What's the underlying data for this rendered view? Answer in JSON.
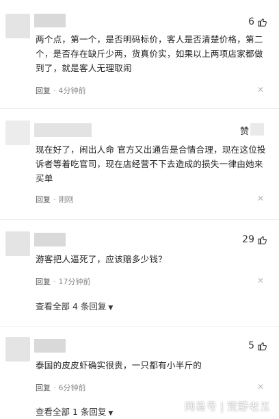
{
  "reply_label": "回复",
  "comments": [
    {
      "likes": "6",
      "text": "两个点，第一个，是否明码标价，客人是否清楚价格，第二个，是否存在缺斤少两，货真价实，如果以上两项店家都做到了，就是客人无理取闹",
      "time": "4分钟前"
    },
    {
      "badge": "赞",
      "text": "现在好了，闹出人命 官方又出通告是合情合理，现在这位投诉者等着吃官司，现在店经营不下去造成的损失一律由她来买单",
      "time": "刚刚"
    },
    {
      "likes": "29",
      "text": "游客把人逼死了，应该赔多少钱？",
      "time": "17分钟前",
      "view_all": "查看全部 4 条回复"
    },
    {
      "likes": "5",
      "text": "泰国的皮皮虾确实很贵，一只都有小半斤的",
      "time": "6分钟前",
      "view_all": "查看全部 1 条回复"
    }
  ],
  "watermark": {
    "platform": "网易号",
    "author": "荒野老五"
  }
}
